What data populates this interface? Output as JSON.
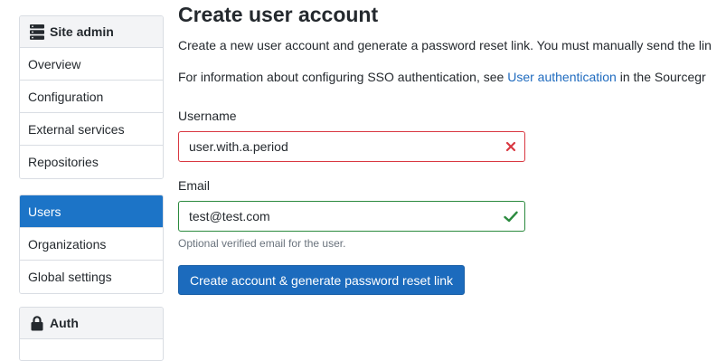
{
  "sidebar": {
    "site_admin": {
      "title": "Site admin",
      "icon": "server-icon",
      "items": [
        {
          "label": "Overview"
        },
        {
          "label": "Configuration"
        },
        {
          "label": "External services"
        },
        {
          "label": "Repositories"
        }
      ]
    },
    "users_group": {
      "items": [
        {
          "label": "Users",
          "active": true
        },
        {
          "label": "Organizations"
        },
        {
          "label": "Global settings"
        }
      ]
    },
    "auth": {
      "title": "Auth",
      "icon": "lock-icon"
    }
  },
  "main": {
    "title": "Create user account",
    "intro": "Create a new user account and generate a password reset link. You must manually send the lin",
    "sso_prefix": "For information about configuring SSO authentication, see ",
    "sso_link": "User authentication",
    "sso_suffix": " in the Sourcegr",
    "username": {
      "label": "Username",
      "value": "user.with.a.period",
      "status": "invalid",
      "status_icon": "x-icon"
    },
    "email": {
      "label": "Email",
      "value": "test@test.com",
      "status": "valid",
      "status_icon": "check-icon",
      "help": "Optional verified email for the user."
    },
    "submit_label": "Create account & generate password reset link"
  },
  "colors": {
    "active_nav": "#1c74c7",
    "primary_button": "#1c6bbd",
    "link": "#1f6bbf",
    "invalid": "#d93841",
    "valid": "#2b8a3e"
  }
}
